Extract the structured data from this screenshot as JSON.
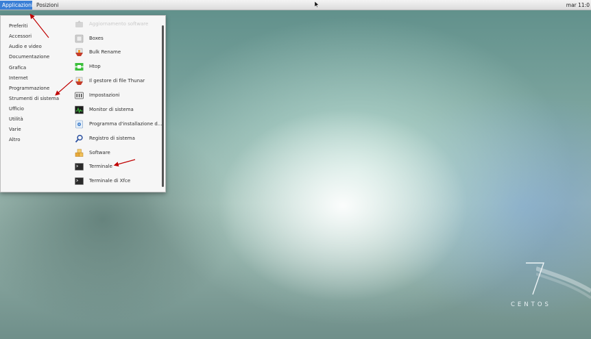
{
  "topbar": {
    "applications_label": "Applicazioni",
    "places_label": "Posizioni",
    "clock": "mar 11:0"
  },
  "menu": {
    "categories": [
      "Preferiti",
      "Accessori",
      "Audio e video",
      "Documentazione",
      "Grafica",
      "Internet",
      "Programmazione",
      "Strumenti di sistema",
      "Ufficio",
      "Utilità",
      "Varie",
      "Altro"
    ],
    "apps": [
      {
        "label": "Aggiornamento software",
        "icon": "software-update-icon",
        "faded": true
      },
      {
        "label": "Boxes",
        "icon": "boxes-icon"
      },
      {
        "label": "Bulk Rename",
        "icon": "bulk-rename-icon"
      },
      {
        "label": "Htop",
        "icon": "htop-icon"
      },
      {
        "label": "Il gestore di file Thunar",
        "icon": "thunar-icon"
      },
      {
        "label": "Impostazioni",
        "icon": "settings-icon"
      },
      {
        "label": "Monitor di sistema",
        "icon": "system-monitor-icon"
      },
      {
        "label": "Programma d'installazione d...",
        "icon": "installer-icon"
      },
      {
        "label": "Registro di sistema",
        "icon": "system-log-icon"
      },
      {
        "label": "Software",
        "icon": "software-icon"
      },
      {
        "label": "Terminale",
        "icon": "terminal-icon"
      },
      {
        "label": "Terminale di Xfce",
        "icon": "xfce-terminal-icon"
      }
    ]
  },
  "wallpaper": {
    "logo_number": "7",
    "logo_text": "CENTOS"
  },
  "colors": {
    "accent": "#3a7fd6",
    "annotation_arrow": "#c00000"
  }
}
